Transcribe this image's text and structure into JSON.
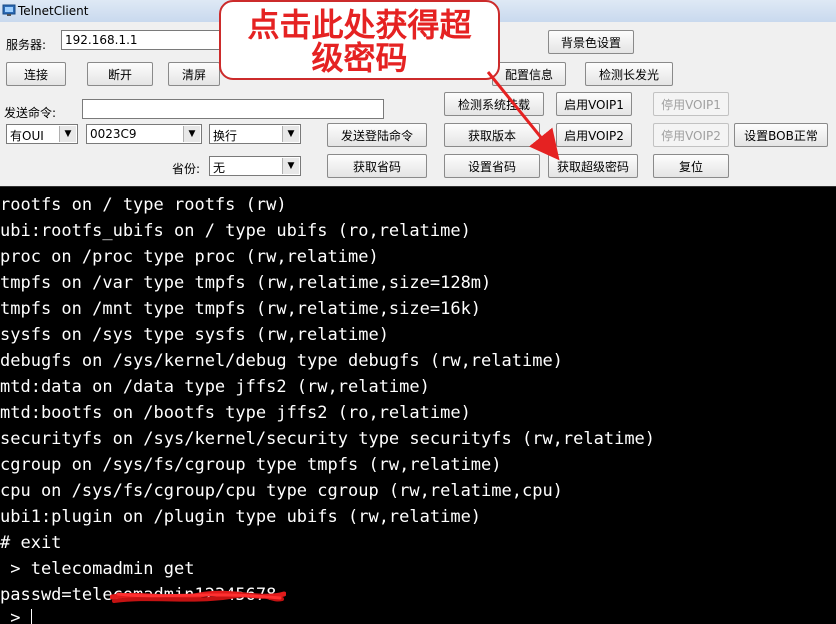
{
  "window": {
    "title": "TelnetClient"
  },
  "form": {
    "server_label": "服务器:",
    "server_value": "192.168.1.1",
    "send_label": "发送命令:",
    "send_value": "",
    "province_label": "省份:",
    "combo_oui": "有OUI",
    "combo_code": "0023C9",
    "combo_newline": "换行",
    "combo_province": "无"
  },
  "buttons": {
    "connect": "连接",
    "disconnect": "断开",
    "clear": "清屏",
    "read_config": "配置信息",
    "bg_color": "背景色设置",
    "check_led": "检测长发光",
    "check_system": "检测系统挂载",
    "enable_voip1": "启用VOIP1",
    "disable_voip1": "停用VOIP1",
    "send_login": "发送登陆命令",
    "get_version": "获取版本",
    "enable_voip2": "启用VOIP2",
    "disable_voip2": "停用VOIP2",
    "set_bob": "设置BOB正常",
    "get_province": "获取省码",
    "set_province": "设置省码",
    "get_super_password": "获取超级密码",
    "reset": "复位"
  },
  "terminal": {
    "lines": [
      "rootfs on / type rootfs (rw)",
      "ubi:rootfs_ubifs on / type ubifs (ro,relatime)",
      "proc on /proc type proc (rw,relatime)",
      "tmpfs on /var type tmpfs (rw,relatime,size=128m)",
      "tmpfs on /mnt type tmpfs (rw,relatime,size=16k)",
      "sysfs on /sys type sysfs (rw,relatime)",
      "debugfs on /sys/kernel/debug type debugfs (rw,relatime)",
      "mtd:data on /data type jffs2 (rw,relatime)",
      "mtd:bootfs on /bootfs type jffs2 (ro,relatime)",
      "securityfs on /sys/kernel/security type securityfs (rw,relatime)",
      "cgroup on /sys/fs/cgroup type tmpfs (rw,relatime)",
      "cpu on /sys/fs/cgroup/cpu type cgroup (rw,relatime,cpu)",
      "ubi1:plugin on /plugin type ubifs (rw,relatime)",
      "# exit",
      " > telecomadmin get",
      "passwd=telecomadmin12345678",
      " > "
    ]
  },
  "annotation": {
    "line1": "点击此处获得超",
    "line2": "级密码",
    "color": "#e52222"
  }
}
